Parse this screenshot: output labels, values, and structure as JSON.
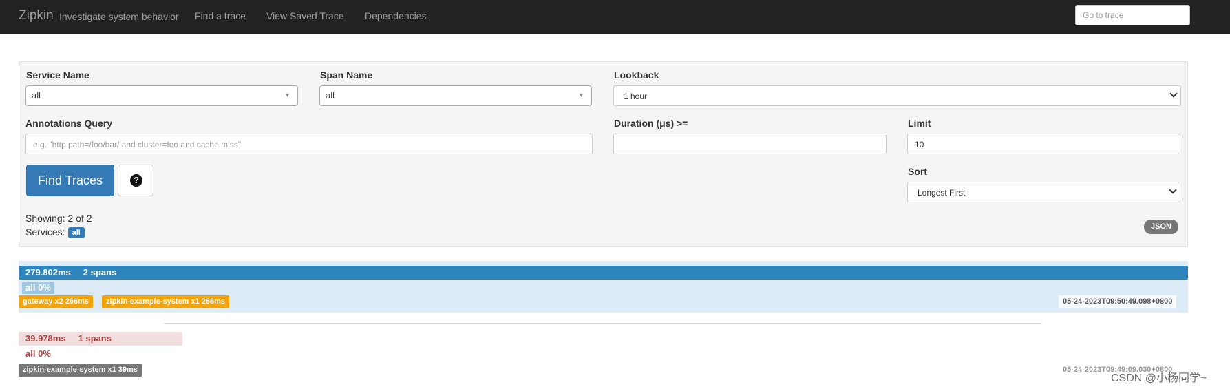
{
  "nav": {
    "brand": "Zipkin",
    "tagline": "Investigate system behavior",
    "links": [
      "Find a trace",
      "View Saved Trace",
      "Dependencies"
    ],
    "goto_placeholder": "Go to trace"
  },
  "search": {
    "service_label": "Service Name",
    "service_value": "all",
    "span_label": "Span Name",
    "span_value": "all",
    "lookback_label": "Lookback",
    "lookback_value": "1 hour",
    "annotations_label": "Annotations Query",
    "annotations_placeholder": "e.g. \"http.path=/foo/bar/ and cluster=foo and cache.miss\"",
    "duration_label": "Duration (μs) >=",
    "duration_value": "",
    "limit_label": "Limit",
    "limit_value": "10",
    "sort_label": "Sort",
    "sort_value": "Longest First",
    "find_button": "Find Traces",
    "help_icon": "question-circle-icon",
    "help_glyph": "?",
    "showing": "Showing: 2 of 2",
    "services_label": "Services:",
    "services_badge": "all",
    "json_badge": "JSON"
  },
  "traces": [
    {
      "duration": "279.802ms",
      "spans": "2 spans",
      "service_pct": "all 0%",
      "services": [
        "gateway x2 266ms",
        "zipkin-example-system x1 266ms"
      ],
      "timestamp": "05-24-2023T09:50:49.098+0800"
    },
    {
      "duration": "39.978ms",
      "spans": "1 spans",
      "service_pct": "all 0%",
      "services": [
        "zipkin-example-system x1 39ms"
      ],
      "timestamp": "05-24-2023T09:49:09.030+0800"
    }
  ],
  "watermark": "CSDN @小杨同学~",
  "colors": {
    "navbar": "#222222",
    "primary": "#337ab7",
    "trace_bar": "#2f86bf",
    "service_orange": "#f0a30a",
    "error_bg": "#f2dede",
    "error_text": "#a94442"
  }
}
